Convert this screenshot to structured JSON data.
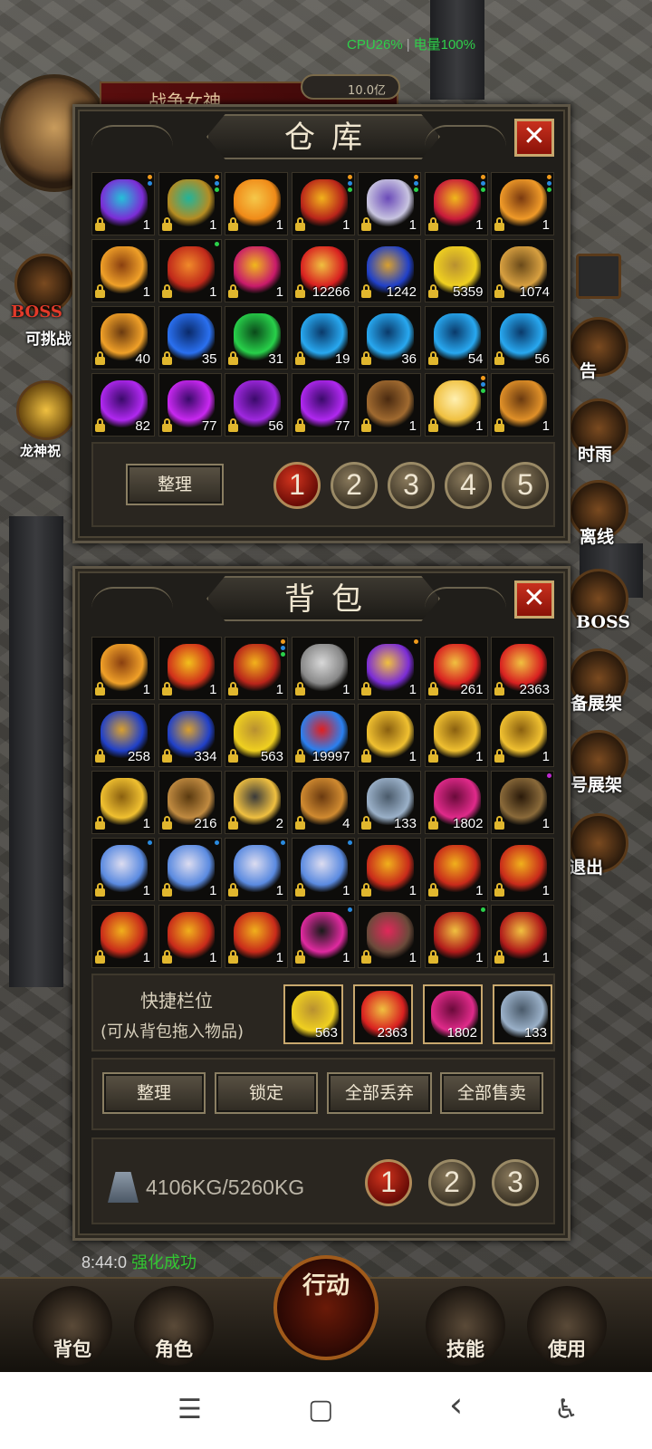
{
  "status": {
    "cpu": "CPU26%",
    "battery": "电量100%"
  },
  "player": {
    "name": "战争女神",
    "gold": "10.0亿"
  },
  "left_widgets": {
    "boss_label": "BOSS",
    "challenge": "可挑战",
    "dragon": "龙神祝"
  },
  "right_widgets": [
    "告",
    "时雨",
    "离线",
    "BOSS",
    "备展架",
    "号展架",
    "退出"
  ],
  "warehouse": {
    "title": "仓库",
    "items": [
      {
        "icon": "necklace",
        "qty": "1",
        "colors": [
          "#7b2cd6",
          "#25c1d8"
        ],
        "dots": [
          "#f09a1c",
          "#2a8be0"
        ]
      },
      {
        "icon": "jade-necklace",
        "qty": "1",
        "colors": [
          "#b58c22",
          "#22b49a"
        ],
        "dots": [
          "#f09a1c",
          "#2a8be0",
          "#2ad14a"
        ]
      },
      {
        "icon": "flame-sword",
        "qty": "1",
        "colors": [
          "#f08a18",
          "#f5c84a"
        ],
        "dots": []
      },
      {
        "icon": "gold-helmet",
        "qty": "1",
        "colors": [
          "#b8241a",
          "#f2b21c"
        ],
        "dots": [
          "#f09a1c",
          "#2a8be0",
          "#2ad14a"
        ]
      },
      {
        "icon": "silver-blade",
        "qty": "1",
        "colors": [
          "#c8c4e0",
          "#6a4ab8"
        ],
        "dots": [
          "#f09a1c",
          "#2a8be0",
          "#2ad14a"
        ]
      },
      {
        "icon": "ruby-necklace",
        "qty": "1",
        "colors": [
          "#c81a3a",
          "#f0b81c"
        ],
        "dots": [
          "#f09a1c",
          "#2a8be0",
          "#2ad14a"
        ]
      },
      {
        "icon": "curved-blade",
        "qty": "1",
        "colors": [
          "#f09a28",
          "#7a3a10"
        ],
        "dots": [
          "#f09a1c",
          "#2a8be0",
          "#2ad14a"
        ]
      },
      {
        "icon": "golden-sword",
        "qty": "1",
        "colors": [
          "#f0a028",
          "#8a4010"
        ],
        "dots": []
      },
      {
        "icon": "red-bracelet",
        "qty": "1",
        "colors": [
          "#c0281a",
          "#f08a2a"
        ],
        "dots": [
          "#2ad14a"
        ]
      },
      {
        "icon": "pink-bracelet",
        "qty": "1",
        "colors": [
          "#c81a6a",
          "#f0b81c"
        ],
        "dots": []
      },
      {
        "icon": "red-potion",
        "qty": "12266",
        "colors": [
          "#d82020",
          "#f0c040"
        ],
        "dots": []
      },
      {
        "icon": "blue-potion",
        "qty": "1242",
        "colors": [
          "#2040c8",
          "#d8a030"
        ],
        "dots": []
      },
      {
        "icon": "sun-potion",
        "qty": "5359",
        "colors": [
          "#f0d020",
          "#b89030"
        ],
        "dots": []
      },
      {
        "icon": "gold-ore",
        "qty": "1074",
        "colors": [
          "#d8a040",
          "#6a4a1a"
        ],
        "dots": []
      },
      {
        "icon": "orange-orb",
        "qty": "40",
        "colors": [
          "#f0a028",
          "#6a3a10"
        ],
        "dots": []
      },
      {
        "icon": "blue-orb",
        "qty": "35",
        "colors": [
          "#2a70f0",
          "#0a2a6a"
        ],
        "dots": []
      },
      {
        "icon": "green-orb",
        "qty": "31",
        "colors": [
          "#28d04a",
          "#0a4a1a"
        ],
        "dots": []
      },
      {
        "icon": "cyan-orb",
        "qty": "19",
        "colors": [
          "#28a8f0",
          "#0a3a6a"
        ],
        "dots": []
      },
      {
        "icon": "cyan-orb",
        "qty": "36",
        "colors": [
          "#28a8f0",
          "#0a3a6a"
        ],
        "dots": []
      },
      {
        "icon": "cyan-orb",
        "qty": "54",
        "colors": [
          "#28a8f0",
          "#0a3a6a"
        ],
        "dots": []
      },
      {
        "icon": "cyan-orb",
        "qty": "56",
        "colors": [
          "#28a8f0",
          "#0a3a6a"
        ],
        "dots": []
      },
      {
        "icon": "purple-orb",
        "qty": "82",
        "colors": [
          "#b028f0",
          "#3a0a6a"
        ],
        "dots": []
      },
      {
        "icon": "purple-orb",
        "qty": "77",
        "colors": [
          "#c828f0",
          "#3a0a6a"
        ],
        "dots": []
      },
      {
        "icon": "purple-orb",
        "qty": "56",
        "colors": [
          "#a028e0",
          "#3a0a6a"
        ],
        "dots": []
      },
      {
        "icon": "purple-orb",
        "qty": "77",
        "colors": [
          "#b028f0",
          "#3a0a6a"
        ],
        "dots": []
      },
      {
        "icon": "wooden-sword",
        "qty": "1",
        "colors": [
          "#a06a30",
          "#4a2a10"
        ],
        "dots": []
      },
      {
        "icon": "dragon-sword",
        "qty": "1",
        "colors": [
          "#f0c040",
          "#fff0b0"
        ],
        "dots": [
          "#f09a1c",
          "#2a8be0",
          "#2ad14a"
        ]
      },
      {
        "icon": "bronze-sword",
        "qty": "1",
        "colors": [
          "#e09028",
          "#6a3a10"
        ],
        "dots": []
      }
    ],
    "sort_label": "整理",
    "pages": [
      "1",
      "2",
      "3",
      "4",
      "5"
    ],
    "active_page": "1"
  },
  "bag": {
    "title": "背包",
    "items": [
      {
        "icon": "golden-sword",
        "qty": "1",
        "colors": [
          "#f0a028",
          "#8a4010"
        ],
        "dots": []
      },
      {
        "icon": "gold-armor",
        "qty": "1",
        "colors": [
          "#d0301a",
          "#f2c01c"
        ],
        "dots": []
      },
      {
        "icon": "gold-helmet",
        "qty": "1",
        "colors": [
          "#b8241a",
          "#f2b21c"
        ],
        "dots": [
          "#f09a1c",
          "#2a8be0",
          "#2ad14a"
        ]
      },
      {
        "icon": "dark-necklace",
        "qty": "1",
        "colors": [
          "#888",
          "#d8d8d8"
        ],
        "dots": []
      },
      {
        "icon": "purple-necklace",
        "qty": "1",
        "colors": [
          "#7b2cd6",
          "#f0c040"
        ],
        "dots": [
          "#f09a1c"
        ]
      },
      {
        "icon": "red-potion",
        "qty": "261",
        "colors": [
          "#d82020",
          "#f0c040"
        ],
        "dots": []
      },
      {
        "icon": "red-potion",
        "qty": "2363",
        "colors": [
          "#d82020",
          "#f0c040"
        ],
        "dots": []
      },
      {
        "icon": "blue-potion",
        "qty": "258",
        "colors": [
          "#2040c8",
          "#d8a030"
        ],
        "dots": []
      },
      {
        "icon": "blue-potion",
        "qty": "334",
        "colors": [
          "#2040c8",
          "#d8a030"
        ],
        "dots": []
      },
      {
        "icon": "sun-potion",
        "qty": "563",
        "colors": [
          "#f0d020",
          "#b89030"
        ],
        "dots": []
      },
      {
        "icon": "blue-box",
        "qty": "19997",
        "colors": [
          "#2a80f0",
          "#e02020"
        ],
        "dots": []
      },
      {
        "icon": "gold-ore",
        "qty": "1",
        "colors": [
          "#f0c030",
          "#8a6010"
        ],
        "dots": []
      },
      {
        "icon": "gold-ore",
        "qty": "1",
        "colors": [
          "#f0c030",
          "#8a6010"
        ],
        "dots": []
      },
      {
        "icon": "gold-ore",
        "qty": "1",
        "colors": [
          "#f0c030",
          "#8a6010"
        ],
        "dots": []
      },
      {
        "icon": "gold-ore",
        "qty": "1",
        "colors": [
          "#f0c030",
          "#8a6010"
        ],
        "dots": []
      },
      {
        "icon": "brown-ore",
        "qty": "216",
        "colors": [
          "#c08a40",
          "#5a3a10"
        ],
        "dots": []
      },
      {
        "icon": "anvil",
        "qty": "2",
        "colors": [
          "#f0c040",
          "#3a3a3a"
        ],
        "dots": []
      },
      {
        "icon": "wooden-stick",
        "qty": "4",
        "colors": [
          "#d08a30",
          "#6a3a10"
        ],
        "dots": []
      },
      {
        "icon": "silver-scroll",
        "qty": "133",
        "colors": [
          "#9ab0c8",
          "#4a5a6a"
        ],
        "dots": []
      },
      {
        "icon": "pink-scroll",
        "qty": "1802",
        "colors": [
          "#e02a8a",
          "#6a0a3a"
        ],
        "dots": []
      },
      {
        "icon": "dark-ring",
        "qty": "1",
        "colors": [
          "#8a6a3a",
          "#2a1a0a"
        ],
        "dots": [
          "#c028d0"
        ]
      },
      {
        "icon": "blue-bracelet",
        "qty": "1",
        "colors": [
          "#5a8ae0",
          "#dcdcf0"
        ],
        "dots": [
          "#2a8be0"
        ]
      },
      {
        "icon": "blue-bracelet",
        "qty": "1",
        "colors": [
          "#5a8ae0",
          "#dcdcf0"
        ],
        "dots": [
          "#2a8be0"
        ]
      },
      {
        "icon": "blue-bracelet",
        "qty": "1",
        "colors": [
          "#5a8ae0",
          "#dcdcf0"
        ],
        "dots": [
          "#2a8be0"
        ]
      },
      {
        "icon": "blue-bracelet",
        "qty": "1",
        "colors": [
          "#5a8ae0",
          "#dcdcf0"
        ],
        "dots": [
          "#2a8be0"
        ]
      },
      {
        "icon": "gold-bracelet",
        "qty": "1",
        "colors": [
          "#c82a1a",
          "#f0b01c"
        ],
        "dots": []
      },
      {
        "icon": "gold-bracelet",
        "qty": "1",
        "colors": [
          "#c82a1a",
          "#f0b01c"
        ],
        "dots": []
      },
      {
        "icon": "gold-bracelet",
        "qty": "1",
        "colors": [
          "#c82a1a",
          "#f0b01c"
        ],
        "dots": []
      },
      {
        "icon": "gold-bracelet",
        "qty": "1",
        "colors": [
          "#c82a1a",
          "#f0b01c"
        ],
        "dots": []
      },
      {
        "icon": "gold-bracelet",
        "qty": "1",
        "colors": [
          "#c82a1a",
          "#f0b01c"
        ],
        "dots": []
      },
      {
        "icon": "gold-bracelet",
        "qty": "1",
        "colors": [
          "#c82a1a",
          "#f0b01c"
        ],
        "dots": []
      },
      {
        "icon": "pink-amulet",
        "qty": "1",
        "colors": [
          "#e02aa0",
          "#1a1a1a"
        ],
        "dots": [
          "#2a8be0"
        ]
      },
      {
        "icon": "dark-bracelet",
        "qty": "1",
        "colors": [
          "#6a4a3a",
          "#e0285a"
        ],
        "dots": []
      },
      {
        "icon": "red-ring",
        "qty": "1",
        "colors": [
          "#b01a1a",
          "#f0c040"
        ],
        "dots": [
          "#2ad14a"
        ]
      },
      {
        "icon": "red-ring",
        "qty": "1",
        "colors": [
          "#b01a1a",
          "#f0c040"
        ],
        "dots": []
      }
    ],
    "quick": {
      "title": "快捷栏位",
      "hint": "(可从背包拖入物品)",
      "slots": [
        {
          "icon": "sun-potion",
          "qty": "563",
          "colors": [
            "#f0d020",
            "#b89030"
          ]
        },
        {
          "icon": "red-potion",
          "qty": "2363",
          "colors": [
            "#d82020",
            "#f0c040"
          ]
        },
        {
          "icon": "pink-scroll",
          "qty": "1802",
          "colors": [
            "#e02a8a",
            "#6a0a3a"
          ]
        },
        {
          "icon": "silver-scroll",
          "qty": "133",
          "colors": [
            "#9ab0c8",
            "#4a5a6a"
          ]
        }
      ]
    },
    "buttons": {
      "sort": "整理",
      "lock": "锁定",
      "discard_all": "全部丢弃",
      "sell_all": "全部售卖"
    },
    "weight": "4106KG/5260KG",
    "pages": [
      "1",
      "2",
      "3"
    ],
    "active_page": "1"
  },
  "bottom": {
    "clock": "8:44:0",
    "clock_msg": "强化成功",
    "action": "行动",
    "bag": "背包",
    "character": "角色",
    "skill": "技能",
    "use": "使用"
  },
  "nav": {
    "menu": "☰",
    "home": "▢",
    "back": "‹",
    "accessibility": "♿"
  }
}
